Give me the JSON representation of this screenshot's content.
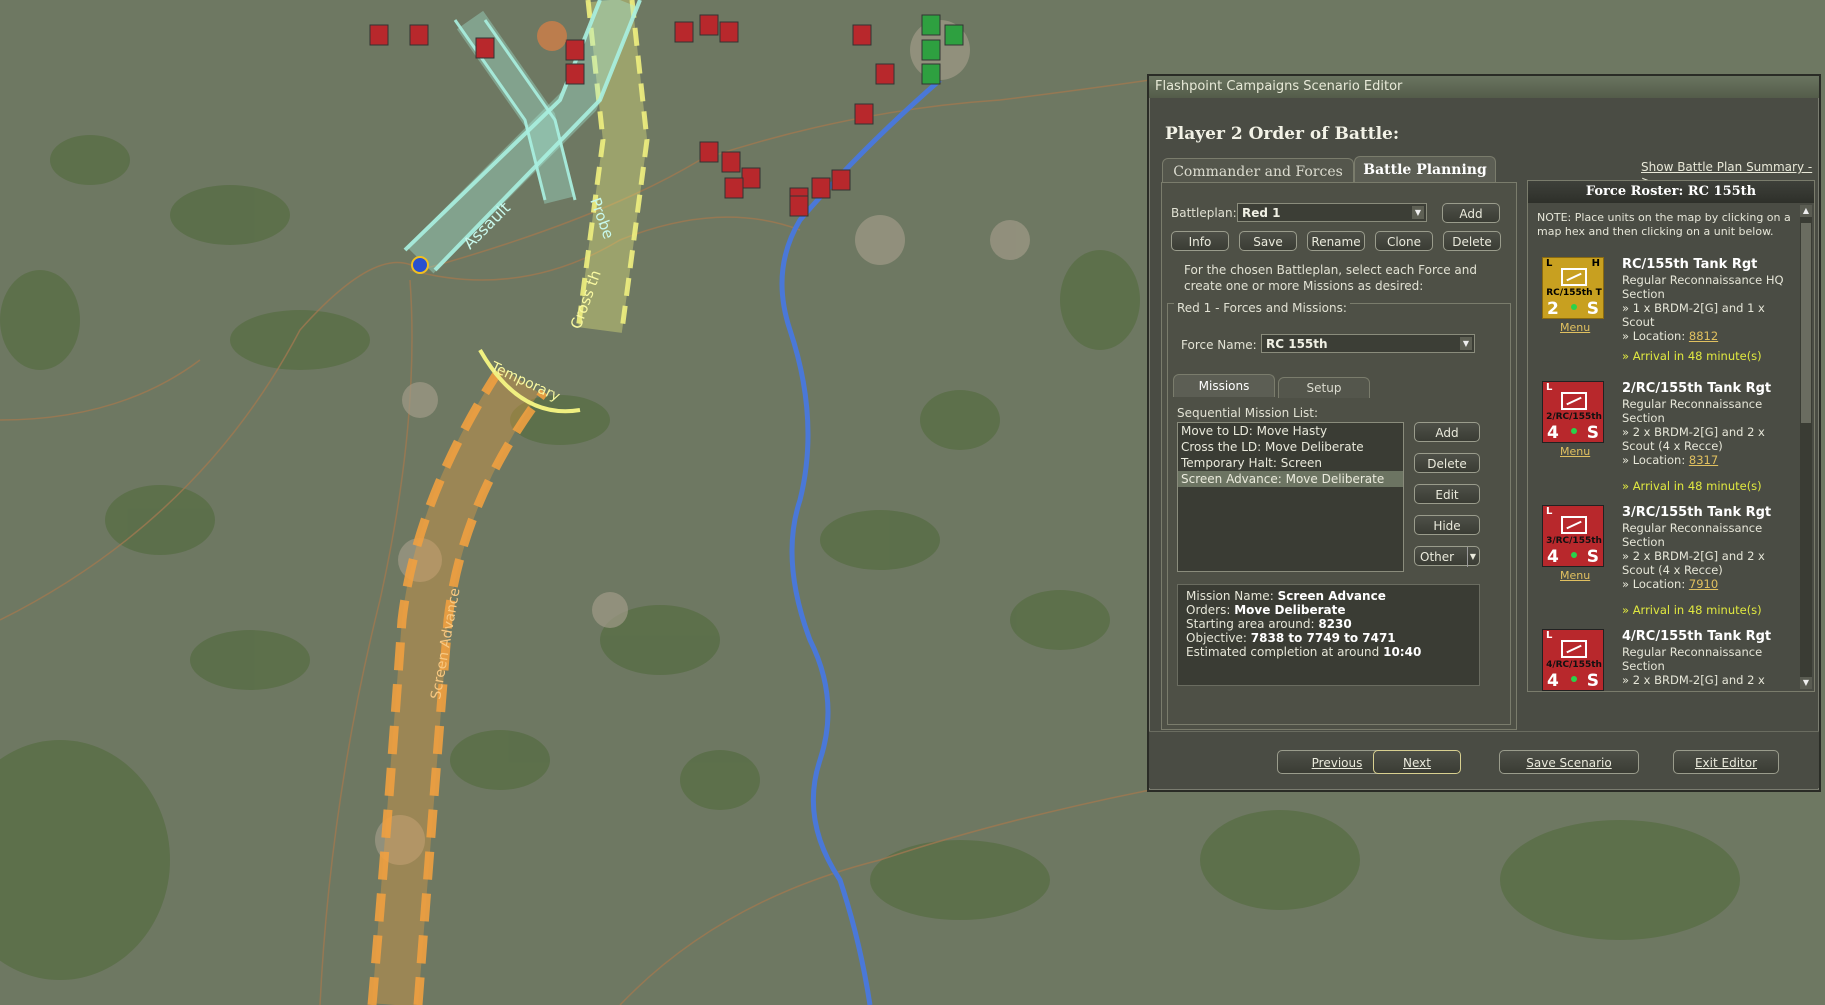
{
  "window": {
    "title": "Flashpoint Campaigns Scenario Editor",
    "heading": "Player 2 Order of Battle:"
  },
  "tabs": [
    {
      "label": "Commander and Forces",
      "active": false
    },
    {
      "label": "Battle Planning",
      "active": true
    }
  ],
  "summary_link": "Show Battle Plan Summary ->",
  "battleplan": {
    "label": "Battleplan:",
    "value": "Red 1",
    "add_label": "Add",
    "buttons": [
      "Info",
      "Save",
      "Rename",
      "Clone",
      "Delete"
    ],
    "instructions": "For the chosen Battleplan, select each Force and create one or more Missions as desired:"
  },
  "forces_group": {
    "title": "Red 1 - Forces and Missions:",
    "force_label": "Force Name:",
    "force_value": "RC 155th",
    "subtabs": [
      "Missions",
      "Setup"
    ],
    "list_label": "Sequential Mission List:",
    "missions": [
      "Move to LD: Move Hasty",
      "Cross the LD: Move Deliberate",
      "Temporary Halt: Screen",
      "Screen Advance: Move Deliberate"
    ],
    "selected_index": 3,
    "mission_buttons": [
      "Add",
      "Delete",
      "Edit",
      "Hide",
      "Other"
    ]
  },
  "mission_info": {
    "name_label": "Mission Name:",
    "name": "Screen Advance",
    "orders_label": "Orders:",
    "orders": "Move Deliberate",
    "start_label": "Starting area around:",
    "start": "8230",
    "objective_label": "Objective:",
    "objective": "7838 to 7749 to 7471",
    "completion_label": "Estimated completion at around",
    "completion": "10:40"
  },
  "roster": {
    "title": "Force Roster: RC 155th",
    "note": "NOTE: Place units on the map by clicking on a map hex and then clicking on a unit below.",
    "units": [
      {
        "counter_label": "RC/155th T",
        "l": "L",
        "h": "H",
        "num": "2",
        "s": "S",
        "color": "#c8a020",
        "name": "RC/155th Tank Rgt",
        "type": "Regular Reconnaissance HQ Section",
        "equip": "» 1 x BRDM-2[G] and 1 x Scout",
        "loc_prefix": "» Location:",
        "loc": "8812",
        "arrival": "» Arrival in 48 minute(s)",
        "menu": "Menu"
      },
      {
        "counter_label": "2/RC/155th",
        "l": "L",
        "h": "",
        "num": "4",
        "s": "S",
        "color": "#b8282c",
        "name": "2/RC/155th Tank Rgt",
        "type": "Regular Reconnaissance Section",
        "equip": "» 2 x BRDM-2[G] and 2 x Scout (4 x Recce)",
        "loc_prefix": "» Location:",
        "loc": "8317",
        "arrival": "» Arrival in 48 minute(s)",
        "menu": "Menu"
      },
      {
        "counter_label": "3/RC/155th",
        "l": "L",
        "h": "",
        "num": "4",
        "s": "S",
        "color": "#b8282c",
        "name": "3/RC/155th Tank Rgt",
        "type": "Regular Reconnaissance Section",
        "equip": "» 2 x BRDM-2[G] and 2 x Scout (4 x Recce)",
        "loc_prefix": "» Location:",
        "loc": "7910",
        "arrival": "» Arrival in 48 minute(s)",
        "menu": "Menu"
      },
      {
        "counter_label": "4/RC/155th",
        "l": "L",
        "h": "",
        "num": "4",
        "s": "S",
        "color": "#b8282c",
        "name": "4/RC/155th Tank Rgt",
        "type": "Regular Reconnaissance Section",
        "equip": "» 2 x BRDM-2[G] and 2 x",
        "loc_prefix": "",
        "loc": "",
        "arrival": "",
        "menu": ""
      }
    ]
  },
  "footer": {
    "previous": "Previous",
    "next": "Next",
    "save": "Save Scenario",
    "exit": "Exit Editor"
  },
  "map_labels": {
    "assault": "Assault",
    "probe": "Probe",
    "cross": "Cross th",
    "temporary": "Temporary",
    "screen": "Screen Advance",
    "rc155": "RC 155th"
  },
  "colors": {
    "assault_arrow": "#a8f0e0",
    "yellow_arrow": "#f0f080",
    "orange_route": "#f0a040",
    "red_unit": "#b8282c",
    "green_unit": "#2ea040",
    "river": "#4a78d8"
  }
}
